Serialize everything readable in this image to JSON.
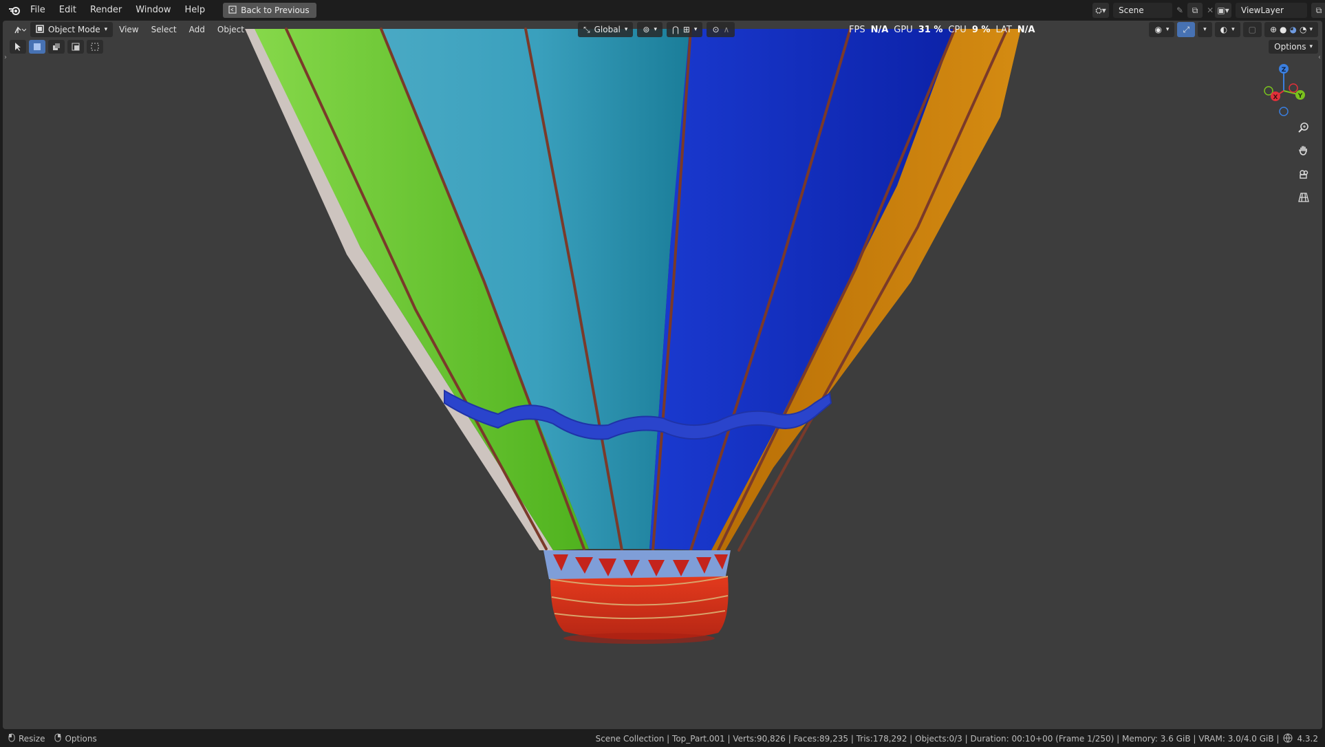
{
  "topbar": {
    "menus": [
      "File",
      "Edit",
      "Render",
      "Window",
      "Help"
    ],
    "back_button": "Back to Previous",
    "scene": "Scene",
    "view_layer": "ViewLayer"
  },
  "viewport": {
    "mode": "Object Mode",
    "menus": [
      "View",
      "Select",
      "Add",
      "Object"
    ],
    "orientation": "Global",
    "options_label": "Options",
    "stats": {
      "fps_label": "FPS",
      "fps_value": "N/A",
      "gpu_label": "GPU",
      "gpu_value": "31 %",
      "cpu_label": "CPU",
      "cpu_value": "9 %",
      "lat_label": "LAT",
      "lat_value": "N/A"
    },
    "gizmo": {
      "z": "Z",
      "x": "X",
      "y": "Y"
    }
  },
  "statusbar": {
    "resize": "Resize",
    "options": "Options",
    "info": "Scene Collection | Top_Part.001 | Verts:90,826 | Faces:89,235 | Tris:178,292 | Objects:0/3 | Duration: 00:10+00 (Frame 1/250) | Memory: 3.6 GiB | VRAM: 3.0/4.0 GiB |",
    "version": "4.3.2"
  },
  "colors": {
    "viewport_bg": "#3d3d3d",
    "green_panel": "#5cc12a",
    "cyan_panel": "#2f9ab8",
    "blue_panel": "#1430c4",
    "orange_panel": "#c97a08",
    "basket_red": "#d8321a",
    "accent": "#4772b3"
  }
}
